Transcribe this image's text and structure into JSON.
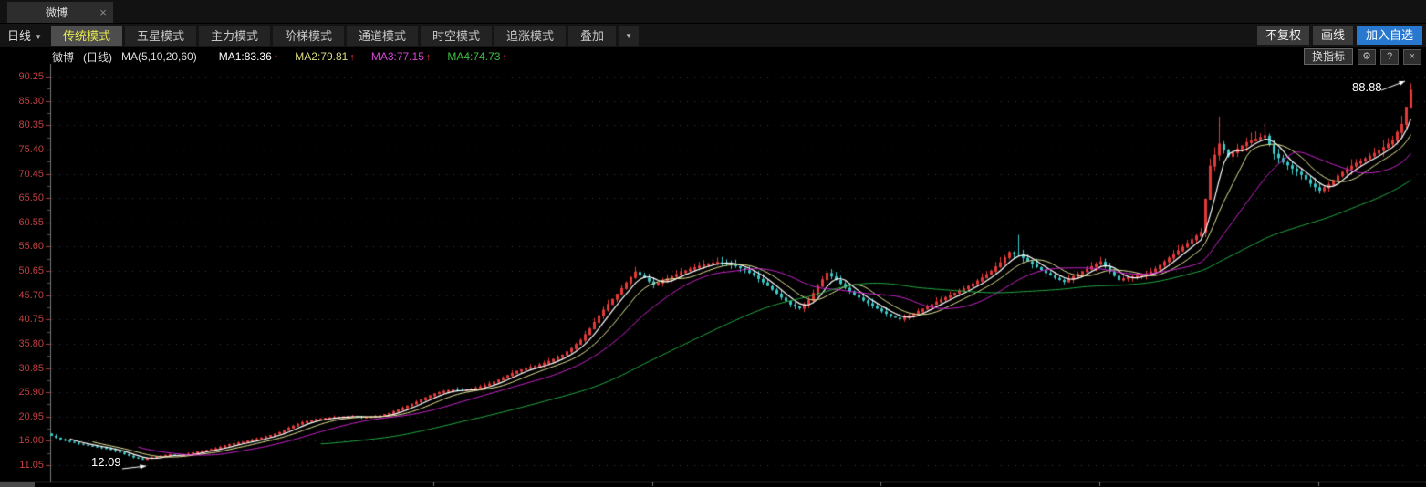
{
  "tabbar": {
    "tab_label": "微博",
    "close_icon": "×"
  },
  "toolbar": {
    "period_label": "日线",
    "caret": "▼",
    "modes": [
      {
        "label": "传统模式",
        "active": true
      },
      {
        "label": "五星模式",
        "active": false
      },
      {
        "label": "主力模式",
        "active": false
      },
      {
        "label": "阶梯模式",
        "active": false
      },
      {
        "label": "通道模式",
        "active": false
      },
      {
        "label": "时空模式",
        "active": false
      },
      {
        "label": "追涨模式",
        "active": false
      }
    ],
    "overlay_label": "叠加",
    "right": {
      "no_adjust": "不复权",
      "draw_line": "画线",
      "add_watchlist": "加入自选"
    }
  },
  "chart_header": {
    "title": "微博",
    "period": "(日线)",
    "ma_label": "MA(5,10,20,60)",
    "arrow_up": "↑",
    "ma_items": [
      {
        "text": "MA1:83.36",
        "color": "#ffffff"
      },
      {
        "text": "MA2:79.81",
        "color": "#dede82"
      },
      {
        "text": "MA3:77.15",
        "color": "#d548d5"
      },
      {
        "text": "MA4:74.73",
        "color": "#3fbf3f"
      }
    ],
    "right": {
      "change_indicator": "换指标",
      "gear": "⚙",
      "help": "?",
      "close": "×"
    }
  },
  "chart_data": {
    "type": "candlestick",
    "title": "微博 日线 (Weibo daily K-line with MA 5/10/20/60)",
    "y_axis": {
      "labels": [
        "90.25",
        "85.30",
        "80.35",
        "75.40",
        "70.45",
        "65.50",
        "60.55",
        "55.60",
        "50.65",
        "45.70",
        "40.75",
        "35.80",
        "30.85",
        "25.90",
        "20.95",
        "16.00",
        "11.05"
      ],
      "top_value": 90.25,
      "bottom_value": 11.05,
      "label_color": "#c04040"
    },
    "annotations": {
      "low": "12.09",
      "high": "88.88"
    },
    "close_series": [
      17.0,
      16.3,
      15.8,
      15.4,
      15.0,
      14.7,
      14.4,
      13.9,
      13.3,
      12.6,
      12.2,
      12.6,
      12.9,
      13.2,
      13.0,
      13.3,
      13.8,
      14.1,
      14.4,
      15.0,
      15.4,
      15.7,
      16.2,
      16.6,
      17.1,
      17.7,
      18.6,
      19.4,
      20.0,
      20.4,
      20.6,
      20.8,
      20.9,
      21.0,
      20.8,
      20.9,
      21.1,
      21.6,
      22.3,
      23.1,
      23.9,
      24.8,
      25.6,
      26.1,
      26.4,
      26.2,
      26.5,
      27.0,
      27.6,
      28.4,
      29.3,
      30.2,
      30.8,
      31.2,
      31.8,
      32.6,
      33.5,
      34.8,
      36.5,
      38.8,
      41.5,
      43.8,
      45.9,
      48.2,
      50.4,
      49.2,
      47.8,
      48.6,
      49.5,
      50.3,
      51.0,
      51.6,
      52.1,
      52.4,
      52.2,
      51.6,
      50.8,
      49.7,
      48.3,
      46.8,
      45.2,
      43.8,
      43.0,
      44.6,
      47.5,
      50.2,
      48.8,
      47.2,
      45.8,
      44.6,
      43.5,
      42.4,
      41.4,
      40.8,
      41.5,
      42.4,
      43.3,
      44.3,
      45.2,
      46.1,
      47.0,
      48.0,
      49.2,
      50.6,
      52.3,
      54.4,
      54.0,
      52.6,
      51.4,
      50.2,
      49.2,
      48.4,
      49.5,
      50.5,
      51.5,
      52.5,
      50.5,
      48.8,
      49.3,
      49.6,
      49.9,
      51.0,
      52.5,
      54.0,
      55.5,
      57.0,
      58.5,
      72.0,
      76.5,
      74.0,
      75.5,
      76.8,
      77.5,
      78.2,
      74.5,
      72.8,
      71.5,
      70.2,
      68.4,
      67.0,
      68.2,
      70.0,
      71.4,
      72.6,
      73.5,
      74.6,
      75.8,
      77.2,
      80.5,
      87.5
    ],
    "wick_overrides": [
      {
        "i": 10,
        "low": 12.09
      },
      {
        "i": 106,
        "high": 58.0
      },
      {
        "i": 128,
        "high": 82.1
      },
      {
        "i": 133,
        "high": 80.8
      },
      {
        "i": 149,
        "high": 88.88
      }
    ],
    "ma_windows": [
      5,
      10,
      20,
      60
    ],
    "colors": {
      "up": "#e23a3a",
      "down": "#3cc8c8",
      "ma1": "#ffffff",
      "ma2": "#e3e396",
      "ma3": "#cc22cc",
      "ma4": "#22aa44",
      "grid": "#383838",
      "axis": "#787878",
      "tick": "#b03636",
      "annotation": "#ffffff"
    }
  }
}
